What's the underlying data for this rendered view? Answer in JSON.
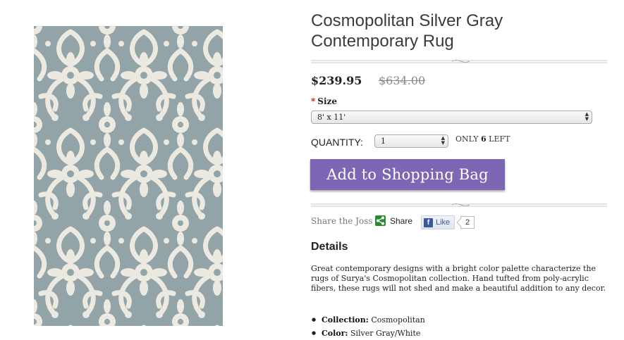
{
  "product": {
    "title": "Cosmopolitan Silver Gray Contemporary Rug",
    "price": "$239.95",
    "original_price": "$634.00",
    "image_alt": "rug-pattern"
  },
  "options": {
    "size_required_mark": "*",
    "size_label": "Size",
    "size_value": "8' x 11'",
    "quantity_label": "QUANTITY:",
    "quantity_value": "1",
    "stock_prefix": "ONLY",
    "stock_count": "6",
    "stock_suffix": "LEFT"
  },
  "cart": {
    "add_label": "Add to Shopping Bag"
  },
  "share": {
    "label": "Share the Joss",
    "share_label": "Share",
    "like_label": "Like",
    "fb_glyph": "f",
    "like_count": "2"
  },
  "details": {
    "heading": "Details",
    "description": "Great contemporary designs with a bright color palette characterize the rugs of Surya's Cosmopolitan collection. Hand tufted from poly-acrylic fibers, these rugs will not shed and make a beautiful addition to any decor.",
    "specs": [
      {
        "label": "Collection:",
        "value": "Cosmopolitan"
      },
      {
        "label": "Color:",
        "value": "Silver Gray/White"
      }
    ]
  },
  "colors": {
    "accent_button": "#7d67b4",
    "rug_base": "#93a4a8",
    "rug_pattern": "#ece9e0",
    "required": "#c0171e"
  }
}
